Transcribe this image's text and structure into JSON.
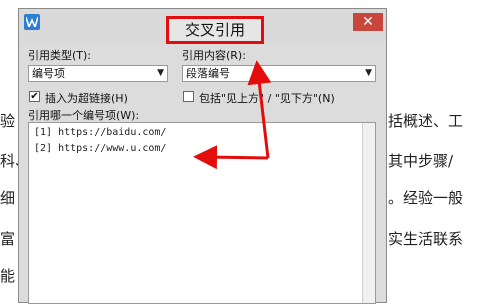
{
  "background": {
    "left_fragments": [
      "验",
      "科、",
      "细",
      "富",
      "能"
    ],
    "right_fragments": [
      "括概述、工",
      "其中步骤/",
      "。经验一般",
      "实生活联系"
    ]
  },
  "dialog": {
    "title": "交叉引用",
    "close_glyph": "✕",
    "ref_type_label": "引用类型(T):",
    "ref_type_value": "编号项",
    "ref_content_label": "引用内容(R):",
    "ref_content_value": "段落编号",
    "hyperlink_label": "插入为超链接(H)",
    "hyperlink_checked": true,
    "above_below_label": "包括\"见上方\" / \"见下方\"(N)",
    "above_below_checked": false,
    "which_item_label": "引用哪一个编号项(W):",
    "items": [
      {
        "prefix": "[1] https://",
        "hidden": "        ",
        "suffix": "baidu.com/"
      },
      {
        "prefix": "[2] https://www.",
        "hidden": "      ",
        "suffix": "u.com/"
      }
    ]
  },
  "colors": {
    "annotation": "#e30d0d"
  }
}
